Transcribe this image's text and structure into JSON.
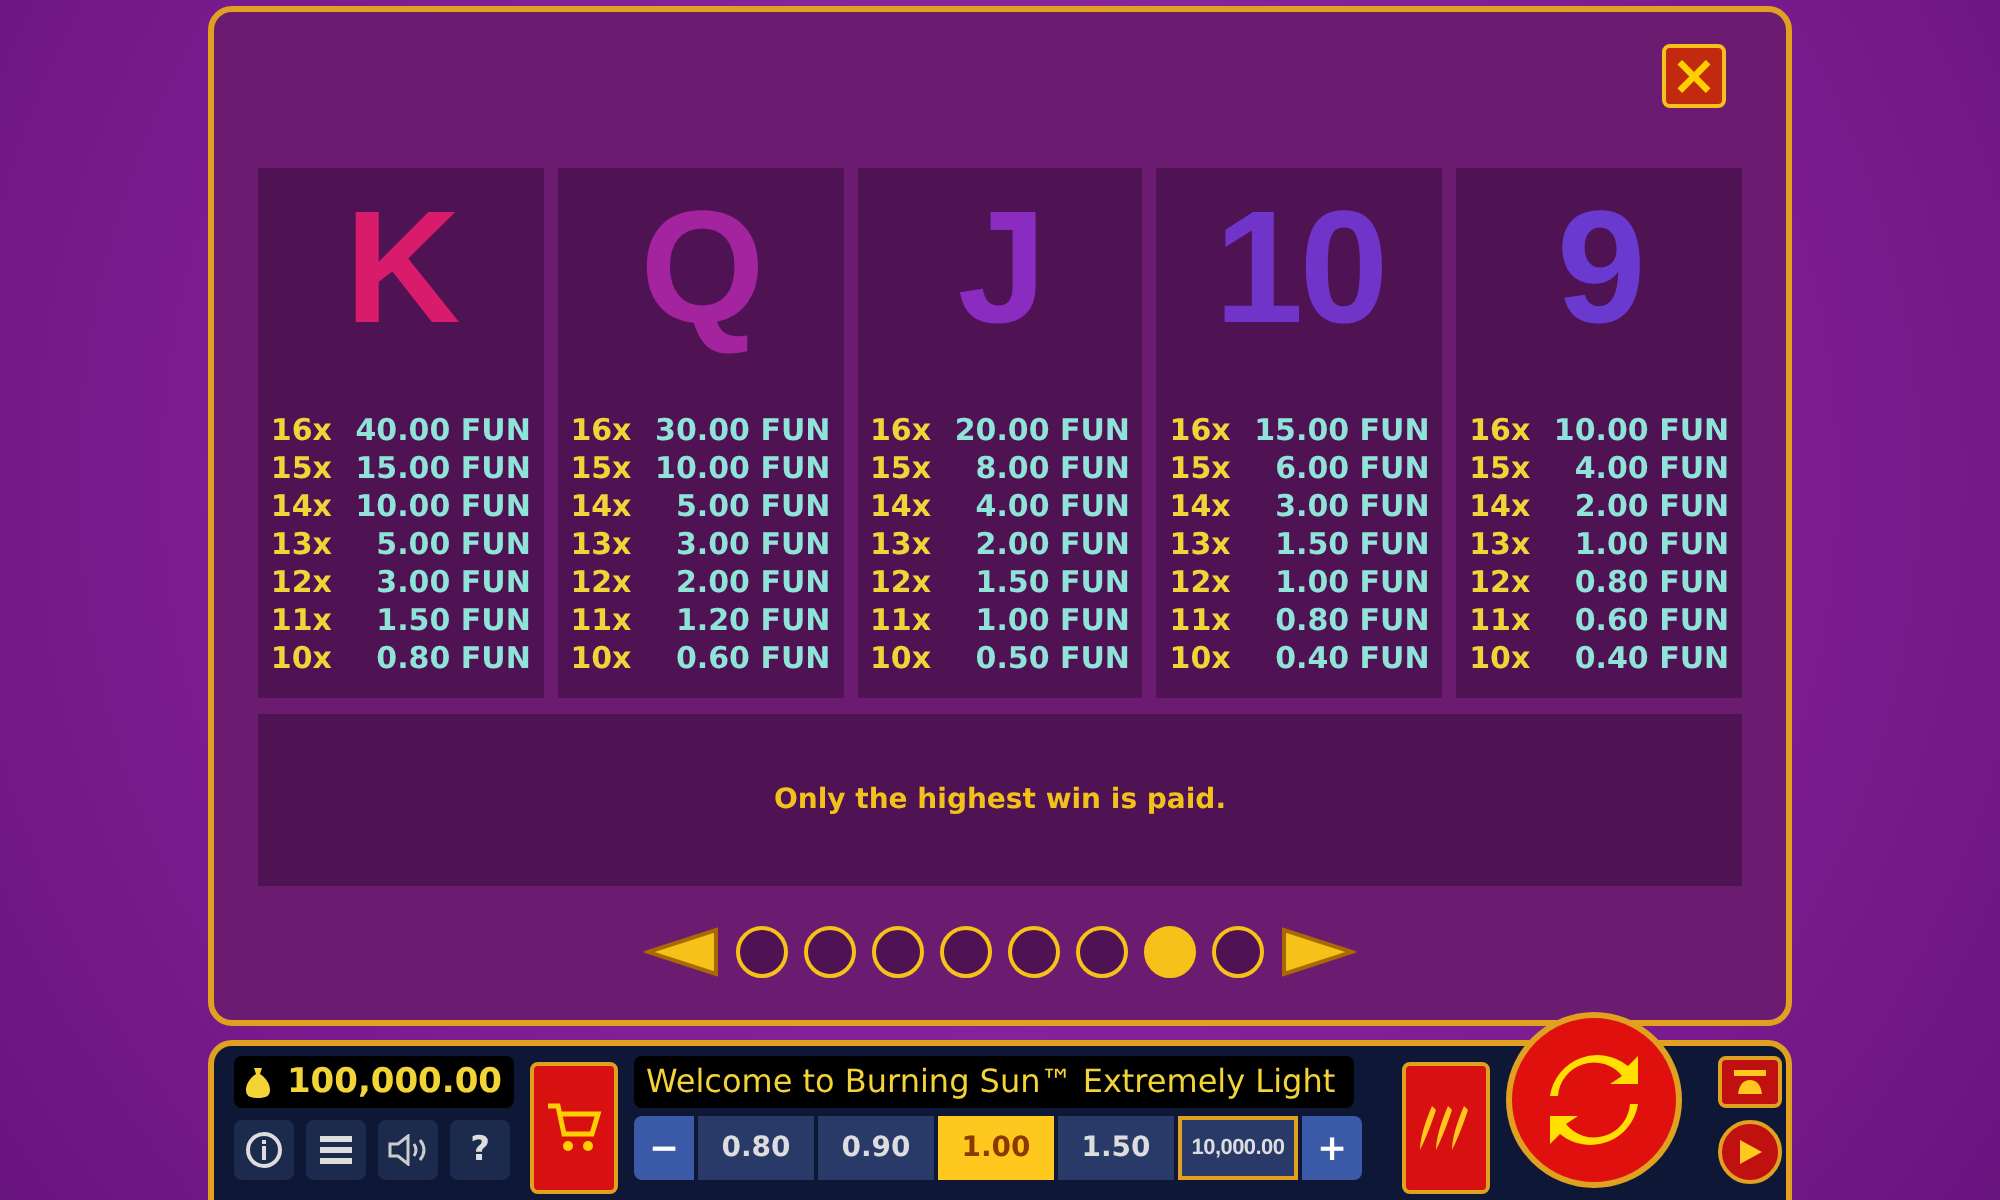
{
  "close_button": "×",
  "symbols": [
    {
      "label": "K",
      "color": "#d81b6a",
      "payouts": [
        [
          "16x",
          "40.00 FUN"
        ],
        [
          "15x",
          "15.00 FUN"
        ],
        [
          "14x",
          "10.00 FUN"
        ],
        [
          "13x",
          "5.00 FUN"
        ],
        [
          "12x",
          "3.00 FUN"
        ],
        [
          "11x",
          "1.50 FUN"
        ],
        [
          "10x",
          "0.80 FUN"
        ]
      ]
    },
    {
      "label": "Q",
      "color": "#a3249e",
      "payouts": [
        [
          "16x",
          "30.00 FUN"
        ],
        [
          "15x",
          "10.00 FUN"
        ],
        [
          "14x",
          "5.00 FUN"
        ],
        [
          "13x",
          "3.00 FUN"
        ],
        [
          "12x",
          "2.00 FUN"
        ],
        [
          "11x",
          "1.20 FUN"
        ],
        [
          "10x",
          "0.60 FUN"
        ]
      ]
    },
    {
      "label": "J",
      "color": "#8a2cc0",
      "payouts": [
        [
          "16x",
          "20.00 FUN"
        ],
        [
          "15x",
          "8.00 FUN"
        ],
        [
          "14x",
          "4.00 FUN"
        ],
        [
          "13x",
          "2.00 FUN"
        ],
        [
          "12x",
          "1.50 FUN"
        ],
        [
          "11x",
          "1.00 FUN"
        ],
        [
          "10x",
          "0.50 FUN"
        ]
      ]
    },
    {
      "label": "10",
      "color": "#7134c8",
      "payouts": [
        [
          "16x",
          "15.00 FUN"
        ],
        [
          "15x",
          "6.00 FUN"
        ],
        [
          "14x",
          "3.00 FUN"
        ],
        [
          "13x",
          "1.50 FUN"
        ],
        [
          "12x",
          "1.00 FUN"
        ],
        [
          "11x",
          "0.80 FUN"
        ],
        [
          "10x",
          "0.40 FUN"
        ]
      ]
    },
    {
      "label": "9",
      "color": "#6a3ad0",
      "payouts": [
        [
          "16x",
          "10.00 FUN"
        ],
        [
          "15x",
          "4.00 FUN"
        ],
        [
          "14x",
          "2.00 FUN"
        ],
        [
          "13x",
          "1.00 FUN"
        ],
        [
          "12x",
          "0.80 FUN"
        ],
        [
          "11x",
          "0.60 FUN"
        ],
        [
          "10x",
          "0.40 FUN"
        ]
      ]
    }
  ],
  "note": "Only the highest win is paid.",
  "pages": [
    {
      "selected": false
    },
    {
      "selected": false
    },
    {
      "selected": false
    },
    {
      "selected": false
    },
    {
      "selected": false
    },
    {
      "selected": false
    },
    {
      "selected": true
    },
    {
      "selected": false
    }
  ],
  "balance": "100,000.00",
  "ticker": "Welcome to Burning Sun™ Extremely Light",
  "bet_minus": "−",
  "bets": [
    {
      "label": "0.80",
      "selected": false
    },
    {
      "label": "0.90",
      "selected": false
    },
    {
      "label": "1.00",
      "selected": true
    },
    {
      "label": "1.50",
      "selected": false
    },
    {
      "label": "10,000.00",
      "selected": false,
      "kind": "max"
    }
  ],
  "bet_plus": "+",
  "help_label": "?"
}
